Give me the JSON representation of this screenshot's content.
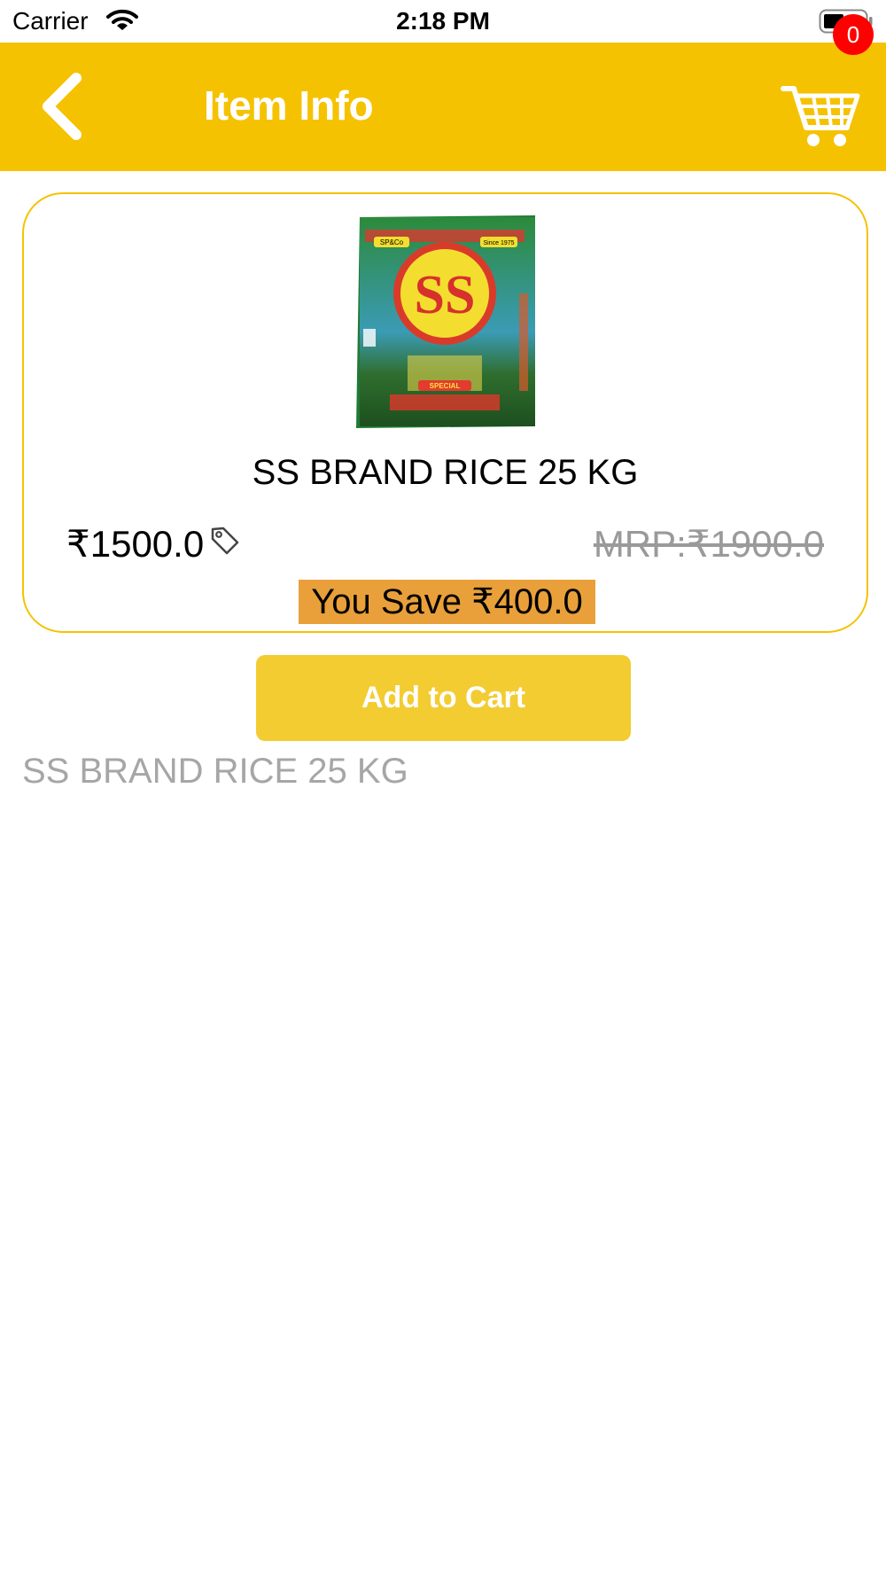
{
  "status_bar": {
    "carrier": "Carrier",
    "time": "2:18 PM"
  },
  "header": {
    "title": "Item Info",
    "back_icon": "chevron-left-icon",
    "cart_icon": "shopping-cart-icon",
    "cart_count": "0",
    "background_color": "#f5c201"
  },
  "product": {
    "name": "SS BRAND RICE 25 KG",
    "price": "₹1500.0",
    "mrp": "MRP:₹1900.0",
    "savings": "You Save ₹400.0",
    "description": "SS BRAND RICE 25 KG",
    "image_logo_text": "SS",
    "image_tag_left": "SP&Co",
    "image_tag_right": "Since 1975",
    "image_label_special": "SPECIAL"
  },
  "actions": {
    "add_to_cart_label": "Add to Cart"
  },
  "colors": {
    "accent": "#f5c201",
    "button": "#f3cc32",
    "savings_badge": "#e9a03a",
    "cart_badge": "#ff0000"
  }
}
